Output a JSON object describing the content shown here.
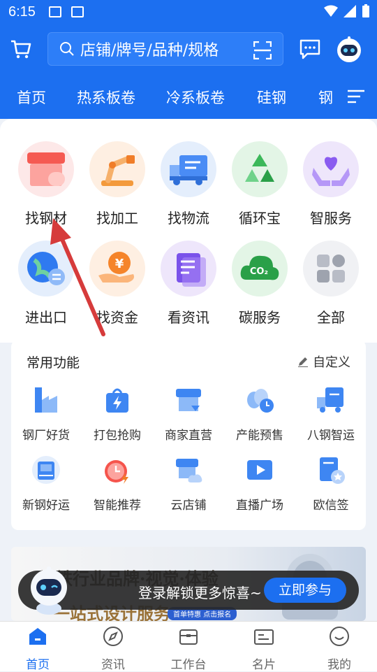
{
  "status": {
    "time": "6:15"
  },
  "search": {
    "placeholder": "店铺/牌号/品种/规格"
  },
  "tabs": [
    {
      "label": "首页"
    },
    {
      "label": "热系板卷"
    },
    {
      "label": "冷系板卷"
    },
    {
      "label": "硅钢"
    },
    {
      "label": "钢"
    }
  ],
  "main_grid": [
    {
      "label": "找钢材",
      "icon": "shop-icon"
    },
    {
      "label": "找加工",
      "icon": "robot-arm-icon"
    },
    {
      "label": "找物流",
      "icon": "truck-icon"
    },
    {
      "label": "循环宝",
      "icon": "recycle-icon"
    },
    {
      "label": "智服务",
      "icon": "heart-hands-icon"
    },
    {
      "label": "进出口",
      "icon": "globe-exchange-icon"
    },
    {
      "label": "找资金",
      "icon": "yen-coin-icon"
    },
    {
      "label": "看资讯",
      "icon": "document-icon"
    },
    {
      "label": "碳服务",
      "icon": "co2-cloud-icon"
    },
    {
      "label": "全部",
      "icon": "grid-icon"
    }
  ],
  "common": {
    "title": "常用功能",
    "custom_label": "自定义",
    "items": [
      {
        "label": "钢厂好货",
        "icon": "factory-icon"
      },
      {
        "label": "打包抢购",
        "icon": "bag-lightning-icon"
      },
      {
        "label": "商家直营",
        "icon": "store-icon"
      },
      {
        "label": "产能预售",
        "icon": "rolls-clock-icon"
      },
      {
        "label": "八钢智运",
        "icon": "truck-icon"
      },
      {
        "label": "新钢好运",
        "icon": "robot-machine-icon"
      },
      {
        "label": "智能推荐",
        "icon": "alarm-clock-icon"
      },
      {
        "label": "云店铺",
        "icon": "cloud-store-icon"
      },
      {
        "label": "直播广场",
        "icon": "video-play-icon"
      },
      {
        "label": "欧信签",
        "icon": "badge-star-icon"
      }
    ]
  },
  "banner": {
    "line1": "钢铁行业品牌·视觉·体验",
    "line2": "一站式设计服务",
    "small": "首单特惠 点击报名"
  },
  "toast": {
    "message": "登录解锁更多惊喜~",
    "button": "立即参与"
  },
  "bottom_nav": [
    {
      "label": "首页",
      "icon": "home-icon",
      "active": true
    },
    {
      "label": "资讯",
      "icon": "compass-icon",
      "active": false
    },
    {
      "label": "工作台",
      "icon": "briefcase-icon",
      "active": false
    },
    {
      "label": "名片",
      "icon": "card-icon",
      "active": false
    },
    {
      "label": "我的",
      "icon": "smile-icon",
      "active": false
    }
  ],
  "colors": {
    "brand": "#1c6ff0",
    "annotation_arrow": "#d63b3b"
  }
}
